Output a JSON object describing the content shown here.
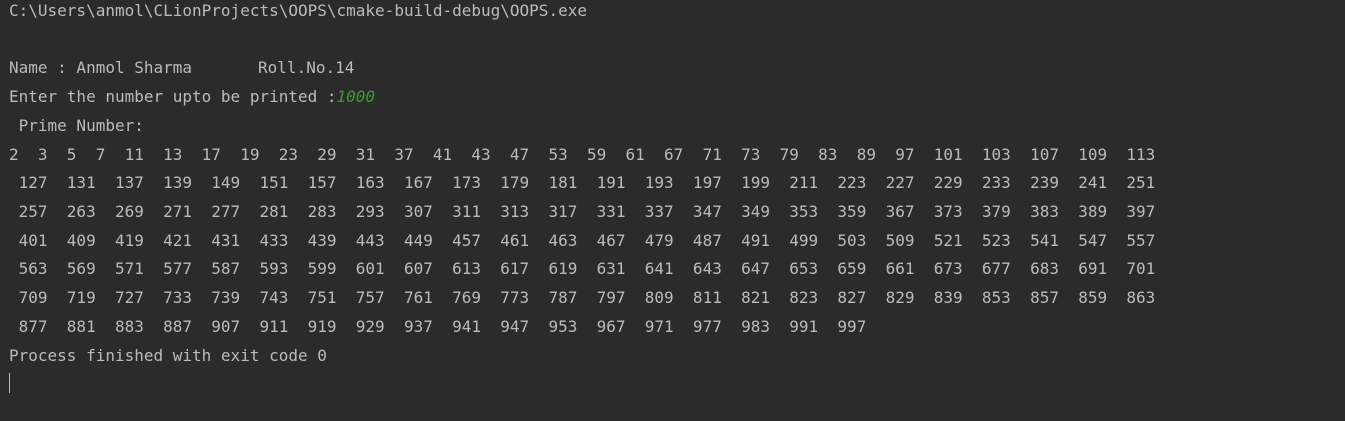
{
  "console": {
    "exe_path": "C:\\Users\\anmol\\CLionProjects\\OOPS\\cmake-build-debug\\OOPS.exe",
    "name_text": "Name : Anmol Sharma",
    "roll_text": "Roll.No.14",
    "prompt_text": "Enter the number upto be printed :",
    "user_input": "1000",
    "prime_header": " Prime Number:",
    "prime_rows": [
      "2  3  5  7  11  13  17  19  23  29  31  37  41  43  47  53  59  61  67  71  73  79  83  89  97  101  103  107  109  113",
      " 127  131  137  139  149  151  157  163  167  173  179  181  191  193  197  199  211  223  227  229  233  239  241  251",
      " 257  263  269  271  277  281  283  293  307  311  313  317  331  337  347  349  353  359  367  373  379  383  389  397",
      " 401  409  419  421  431  433  439  443  449  457  461  463  467  479  487  491  499  503  509  521  523  541  547  557",
      " 563  569  571  577  587  593  599  601  607  613  617  619  631  641  643  647  653  659  661  673  677  683  691  701",
      " 709  719  727  733  739  743  751  757  761  769  773  787  797  809  811  821  823  827  829  839  853  857  859  863",
      " 877  881  883  887  907  911  919  929  937  941  947  953  967  971  977  983  991  997"
    ],
    "exit_text": "Process finished with exit code 0"
  },
  "colors": {
    "background": "#2b2b2b",
    "text": "#bbbbbb",
    "user_input": "#3c9a2f"
  }
}
